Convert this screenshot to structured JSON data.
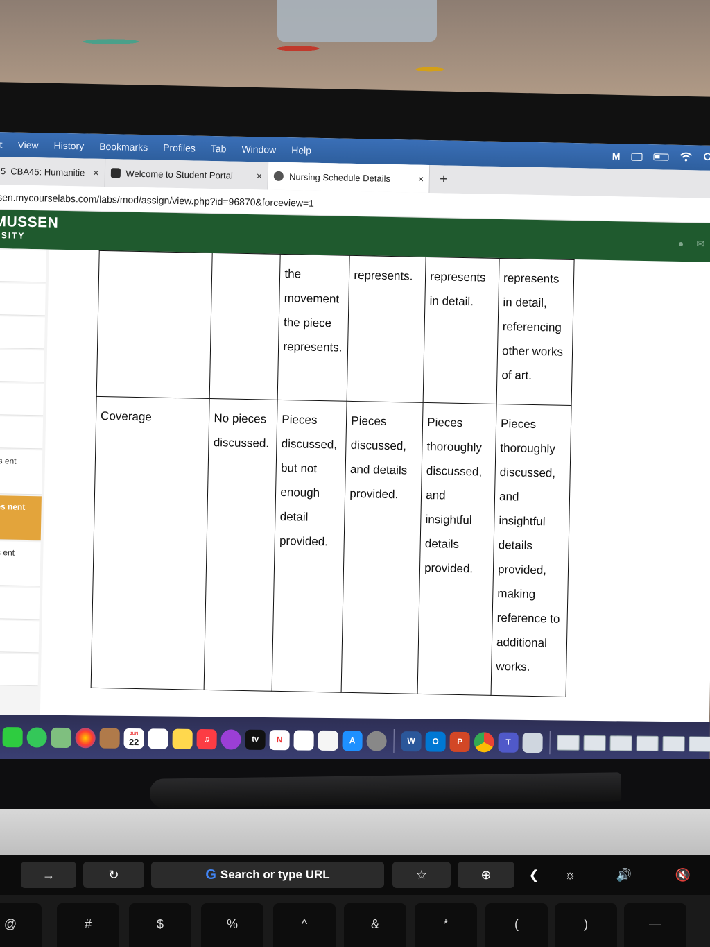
{
  "menubar": {
    "items": [
      "t",
      "View",
      "History",
      "Bookmarks",
      "Profiles",
      "Tab",
      "Window",
      "Help"
    ]
  },
  "tabs": [
    {
      "label": "5_CBA45: Humanitie",
      "close": "×"
    },
    {
      "label": "Welcome to Student Portal",
      "close": "×"
    },
    {
      "label": "Nursing Schedule Details",
      "close": "×"
    }
  ],
  "newtab": "+",
  "url": "sen.mycourselabs.com/labs/mod/assign/view.php?id=96870&forceview=1",
  "site": {
    "logo_line1": "MUSSEN",
    "logo_line2": "RSITY"
  },
  "sidebar": {
    "items": [
      {
        "text": ""
      },
      {
        "text": ""
      },
      {
        "text": ""
      },
      {
        "text": ""
      },
      {
        "text": ""
      },
      {
        "text": ""
      },
      {
        "text": "ties ent"
      },
      {
        "text": "ities nent"
      },
      {
        "text": "ties ent"
      },
      {
        "text": ""
      },
      {
        "text": ""
      },
      {
        "text": ""
      }
    ]
  },
  "rubric": {
    "row1": [
      "",
      "",
      "the movement the piece represents.",
      "represents.",
      "represents in detail.",
      "represents in detail, referencing other works of art."
    ],
    "row2": [
      "Coverage",
      "No pieces discussed.",
      "Pieces discussed, but not enough detail provided.",
      "Pieces discussed, and details provided.",
      "Pieces thoroughly discussed, and insightful details provided.",
      "Pieces thoroughly discussed, and insightful details provided, making reference to additional works."
    ]
  },
  "dock": {
    "calendar_day": "22",
    "calendar_month": "JUN",
    "tv_label": "tv"
  },
  "touchbar": {
    "search_label": "Search or type URL",
    "g_label": "G"
  },
  "keyboard": {
    "keys": [
      "@",
      "#",
      "$",
      "%",
      "^",
      "&",
      "*",
      "(",
      ")",
      "—"
    ]
  },
  "colors": {
    "menubar": "#2e5f9e",
    "site_header": "#1f5a2e",
    "sidebar_active": "#e3a43b",
    "dock": "#34386a"
  }
}
